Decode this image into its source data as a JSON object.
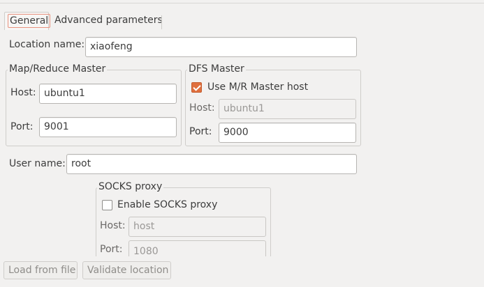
{
  "tabs": {
    "general": "General",
    "advanced": "Advanced parameters"
  },
  "location": {
    "label": "Location name:",
    "value": "xiaofeng"
  },
  "mapreduce": {
    "legend": "Map/Reduce Master",
    "host_label": "Host:",
    "host_value": "ubuntu1",
    "port_label": "Port:",
    "port_value": "9001"
  },
  "dfs": {
    "legend": "DFS Master",
    "use_mr_label": "Use M/R Master host",
    "use_mr_checked": true,
    "host_label": "Host:",
    "host_value": "ubuntu1",
    "port_label": "Port:",
    "port_value": "9000"
  },
  "user": {
    "label": "User name:",
    "value": "root"
  },
  "socks": {
    "legend": "SOCKS proxy",
    "enable_label": "Enable SOCKS proxy",
    "enable_checked": false,
    "host_label": "Host:",
    "host_value": "host",
    "port_label": "Port:",
    "port_value": "1080"
  },
  "buttons": {
    "load": "Load from file",
    "validate": "Validate location"
  },
  "colors": {
    "accent": "#e0703e",
    "background": "#f2f1f0"
  }
}
